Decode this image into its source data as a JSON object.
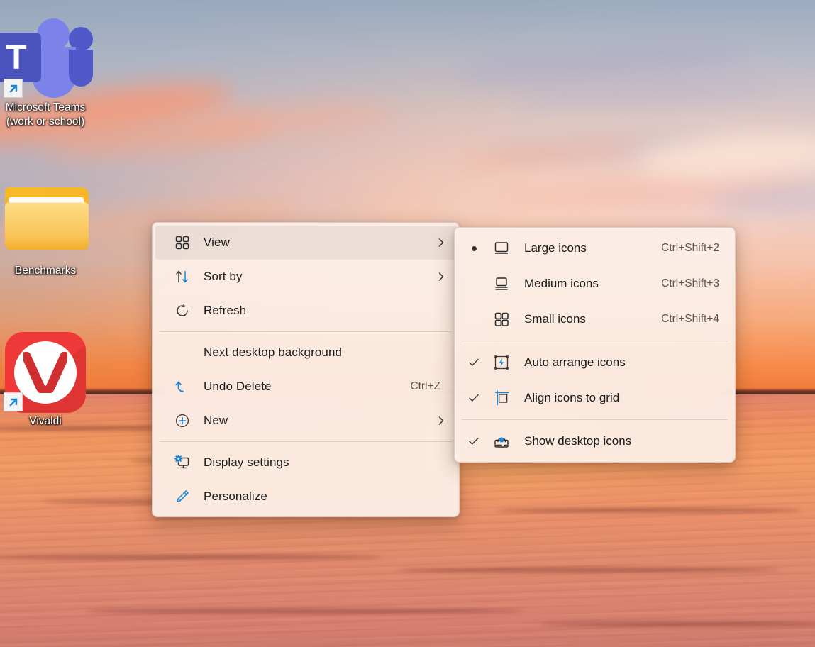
{
  "desktop": {
    "icons": [
      {
        "name": "Microsoft Teams\n(work or school)",
        "icon": "microsoft-teams-icon",
        "shortcut": true
      },
      {
        "name": "Benchmarks",
        "icon": "folder-icon",
        "shortcut": false
      },
      {
        "name": "Vivaldi",
        "icon": "vivaldi-icon",
        "shortcut": true
      }
    ]
  },
  "context_menu": {
    "items": [
      {
        "label": "View",
        "icon": "grid-icon",
        "accel": "",
        "submenu": true,
        "highlighted": true
      },
      {
        "label": "Sort by",
        "icon": "sort-icon",
        "accel": "",
        "submenu": true,
        "highlighted": false
      },
      {
        "label": "Refresh",
        "icon": "refresh-icon",
        "accel": "",
        "submenu": false,
        "highlighted": false
      },
      {
        "separator": true
      },
      {
        "label": "Next desktop background",
        "icon": "",
        "accel": "",
        "submenu": false,
        "highlighted": false
      },
      {
        "label": "Undo Delete",
        "icon": "undo-icon",
        "accel": "Ctrl+Z",
        "submenu": false,
        "highlighted": false
      },
      {
        "label": "New",
        "icon": "plus-circle-icon",
        "accel": "",
        "submenu": true,
        "highlighted": false
      },
      {
        "separator": true
      },
      {
        "label": "Display settings",
        "icon": "monitor-gear-icon",
        "accel": "",
        "submenu": false,
        "highlighted": false
      },
      {
        "label": "Personalize",
        "icon": "paintbrush-icon",
        "accel": "",
        "submenu": false,
        "highlighted": false
      }
    ]
  },
  "view_submenu": {
    "items": [
      {
        "label": "Large icons",
        "icon": "large-icons-icon",
        "accel": "Ctrl+Shift+2",
        "mark": "radio"
      },
      {
        "label": "Medium icons",
        "icon": "medium-icons-icon",
        "accel": "Ctrl+Shift+3",
        "mark": "none"
      },
      {
        "label": "Small icons",
        "icon": "small-icons-icon",
        "accel": "Ctrl+Shift+4",
        "mark": "none"
      },
      {
        "separator": true
      },
      {
        "label": "Auto arrange icons",
        "icon": "auto-arrange-icon",
        "accel": "",
        "mark": "check"
      },
      {
        "label": "Align icons to grid",
        "icon": "align-grid-icon",
        "accel": "",
        "mark": "check"
      },
      {
        "separator": true
      },
      {
        "label": "Show desktop icons",
        "icon": "show-desktop-icons-icon",
        "accel": "",
        "mark": "check"
      }
    ]
  },
  "colors": {
    "menu_background": "#fbf0e9",
    "menu_text": "#1b1b1b",
    "accel_text": "#5c5550",
    "accent_blue": "#0f6cbd",
    "teams_purple": "#4b53bc",
    "vivaldi_red": "#ef3939",
    "folder_yellow": "#f7b829"
  }
}
